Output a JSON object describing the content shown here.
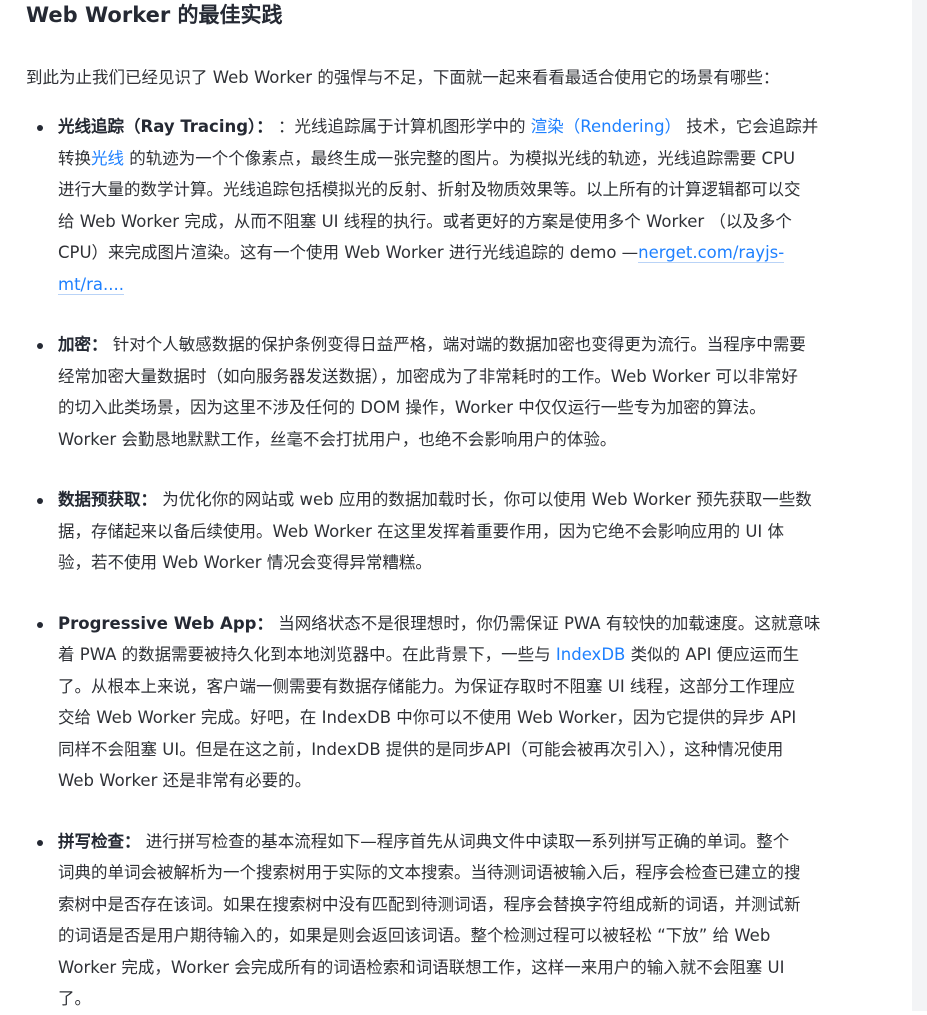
{
  "article": {
    "heading": "Web Worker 的最佳实践",
    "intro": "到此为止我们已经见识了 Web Worker 的强悍与不足，下面就一起来看看最适合使用它的场景有哪些：",
    "items": [
      {
        "title": "光线追踪（Ray Tracing）：",
        "lines": [
          [
            {
              "t": "：光线追踪属于计算机图形学中的 "
            },
            {
              "t": "渲染（Rendering）",
              "link": true
            },
            {
              "t": " 技术，它会追踪并"
            }
          ],
          [
            {
              "t": "转换"
            },
            {
              "t": "光线",
              "link": true
            },
            {
              "t": " 的轨迹为一个个像素点，最终生成一张完整的图片。为模拟光线的轨迹，光线追踪需要 CPU"
            }
          ],
          [
            {
              "t": "进行大量的数学计算。光线追踪包括模拟光的反射、折射及物质效果等。以上所有的计算逻辑都可以交"
            }
          ],
          [
            {
              "t": "给 Web Worker 完成，从而不阻塞 UI 线程的执行。或者更好的方案是使用多个 Worker （以及多个"
            }
          ],
          [
            {
              "t": "CPU）来完成图片渲染。这有一个使用 Web Worker 进行光线追踪的 demo —"
            },
            {
              "t": "nerget.com/rayjs-",
              "link": true,
              "underline": true
            }
          ],
          [
            {
              "t": "mt/ra....",
              "link": true,
              "underline": true
            }
          ]
        ]
      },
      {
        "title": "加密：",
        "lines": [
          [
            {
              "t": "针对个人敏感数据的保护条例变得日益严格，端对端的数据加密也变得更为流行。当程序中需要"
            }
          ],
          [
            {
              "t": "经常加密大量数据时（如向服务器发送数据），加密成为了非常耗时的工作。Web Worker 可以非常好"
            }
          ],
          [
            {
              "t": "的切入此类场景，因为这里不涉及任何的 DOM 操作，Worker 中仅仅运行一些专为加密的算法。"
            }
          ],
          [
            {
              "t": "Worker 会勤恳地默默工作，丝毫不会打扰用户，也绝不会影响用户的体验。"
            }
          ]
        ]
      },
      {
        "title": "数据预获取：",
        "lines": [
          [
            {
              "t": "为优化你的网站或 web 应用的数据加载时长，你可以使用 Web Worker 预先获取一些数"
            }
          ],
          [
            {
              "t": "据，存储起来以备后续使用。Web Worker 在这里发挥着重要作用，因为它绝不会影响应用的 UI 体"
            }
          ],
          [
            {
              "t": "验，若不使用 Web Worker 情况会变得异常糟糕。"
            }
          ]
        ]
      },
      {
        "title": "Progressive Web App：",
        "lines": [
          [
            {
              "t": "当网络状态不是很理想时，你仍需保证 PWA 有较快的加载速度。这就意味"
            }
          ],
          [
            {
              "t": "着 PWA 的数据需要被持久化到本地浏览器中。在此背景下，一些与 "
            },
            {
              "t": "IndexDB",
              "link": true
            },
            {
              "t": " 类似的 API 便应运而生"
            }
          ],
          [
            {
              "t": "了。从根本上来说，客户端一侧需要有数据存储能力。为保证存取时不阻塞 UI 线程，这部分工作理应"
            }
          ],
          [
            {
              "t": "交给 Web Worker 完成。好吧，在 IndexDB 中你可以不使用 Web Worker，因为它提供的异步 API"
            }
          ],
          [
            {
              "t": "同样不会阻塞 UI。但是在这之前，IndexDB 提供的是同步API（可能会被再次引入），这种情况使用"
            }
          ],
          [
            {
              "t": "Web Worker 还是非常有必要的。"
            }
          ]
        ]
      },
      {
        "title": "拼写检查：",
        "lines": [
          [
            {
              "t": "进行拼写检查的基本流程如下—程序首先从词典文件中读取一系列拼写正确的单词。整个"
            }
          ],
          [
            {
              "t": "词典的单词会被解析为一个搜索树用于实际的文本搜索。当待测词语被输入后，程序会检查已建立的搜"
            }
          ],
          [
            {
              "t": "索树中是否存在该词。如果在搜索树中没有匹配到待测词语，程序会替换字符组成新的词语，并测试新"
            }
          ],
          [
            {
              "t": "的词语是否是用户期待输入的，如果是则会返回该词语。整个检测过程可以被轻松 “下放” 给 Web"
            }
          ],
          [
            {
              "t": "Worker 完成，Worker 会完成所有的词语检索和词语联想工作，这样一来用户的输入就不会阻塞 UI"
            }
          ],
          [
            {
              "t": "了。"
            }
          ]
        ]
      }
    ]
  }
}
